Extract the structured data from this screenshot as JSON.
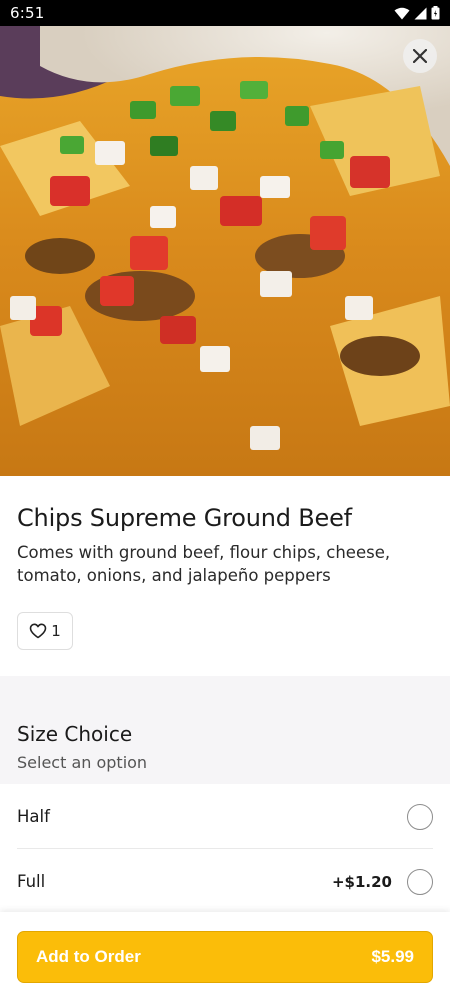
{
  "status_bar": {
    "time": "6:51",
    "icons": [
      "wifi-icon",
      "cell-signal-icon",
      "battery-icon"
    ]
  },
  "hero": {
    "icon": "nachos-photo",
    "close_icon": "close-icon"
  },
  "item": {
    "title": "Chips Supreme Ground Beef",
    "description": "Comes with ground beef, flour chips, cheese, tomato, onions, and jalapeño peppers",
    "like_icon": "heart-icon",
    "like_count": "1"
  },
  "size_choice": {
    "title": "Size Choice",
    "subtitle": "Select an option",
    "options": [
      {
        "label": "Half",
        "price": ""
      },
      {
        "label": "Full",
        "price": "+$1.20"
      }
    ]
  },
  "footer": {
    "add_label": "Add to Order",
    "total": "$5.99"
  },
  "colors": {
    "accent": "#fbbd09",
    "section_bg": "#f6f5f7",
    "status_bar": "#000000"
  }
}
